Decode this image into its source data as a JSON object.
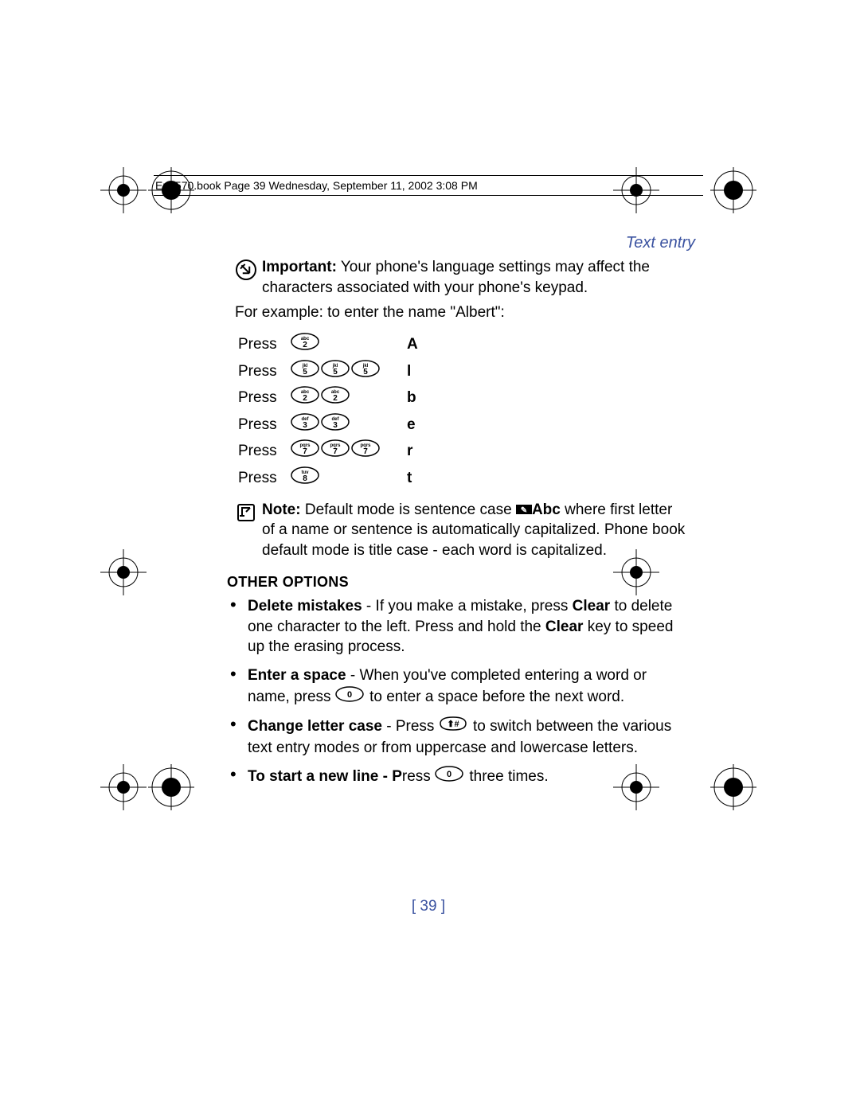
{
  "header": "En3570.book  Page 39  Wednesday, September 11, 2002  3:08 PM",
  "section_title": "Text entry",
  "important": {
    "label": "Important:",
    "text": " Your phone's language settings may affect the characters associated with your phone's keypad."
  },
  "example_intro": "For example: to enter the name \"Albert\":",
  "press_label": "Press",
  "rows": [
    {
      "keys": [
        "2"
      ],
      "result": "A"
    },
    {
      "keys": [
        "5",
        "5",
        "5"
      ],
      "result": "l"
    },
    {
      "keys": [
        "2",
        "2"
      ],
      "result": "b"
    },
    {
      "keys": [
        "3",
        "3"
      ],
      "result": "e"
    },
    {
      "keys": [
        "7",
        "7",
        "7"
      ],
      "result": "r"
    },
    {
      "keys": [
        "8"
      ],
      "result": "t"
    }
  ],
  "note": {
    "label": "Note:",
    "pre": " Default mode is sentence case ",
    "mode_label": "Abc",
    "post": " where first letter of a name or sentence is automatically capitalized. Phone book default mode is title case - each word is capitalized."
  },
  "other_options_heading": "OTHER OPTIONS",
  "options": [
    {
      "lead": "Delete mistakes",
      "pre": " - If you make a mistake, press ",
      "key1": "Clear",
      "mid": " to delete one character to the left. Press and hold the ",
      "key2": "Clear",
      "post": " key to speed up the erasing process."
    },
    {
      "lead": "Enter a space",
      "pre": " - When you've completed entering a word or name, press ",
      "key": "0",
      "post": " to enter a space before the next word."
    },
    {
      "lead": "Change letter case",
      "pre": " - Press ",
      "key": "#",
      "post": " to switch between the various text entry modes or from uppercase and lowercase letters."
    },
    {
      "lead": "To start a new line - P",
      "pre": "ress ",
      "key": "0",
      "post": " three times."
    }
  ],
  "page_number": "[ 39 ]",
  "key_labels": {
    "2": "abc 2",
    "3": "def 3",
    "5": "jkl 5",
    "7": "pqrs 7",
    "8": "tuv 8",
    "0": "0",
    "#": "#"
  }
}
